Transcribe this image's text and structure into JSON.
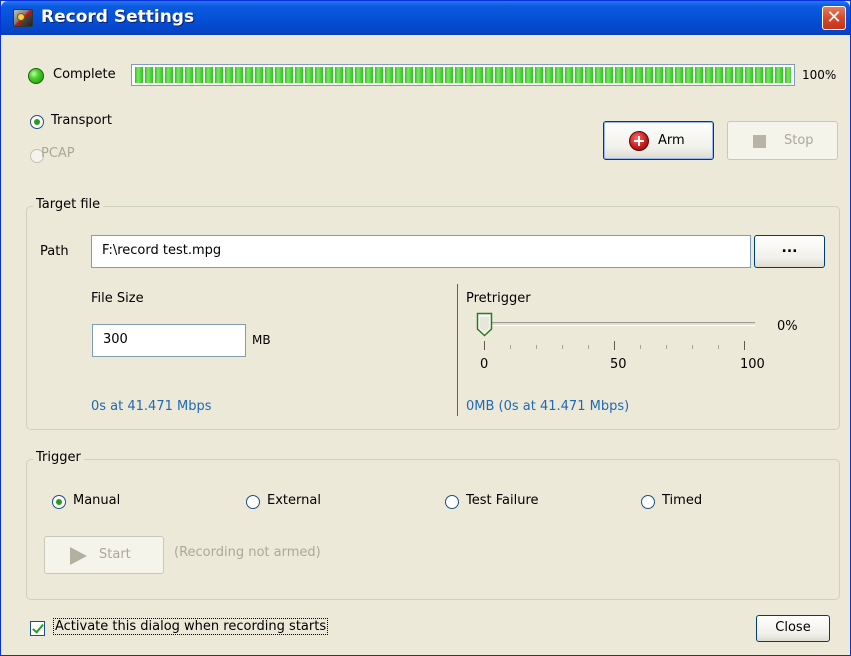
{
  "window": {
    "title": "Record Settings",
    "close_glyph": "✕"
  },
  "progress": {
    "status_label": "Complete",
    "value_percent": 100,
    "percent_label": "100%"
  },
  "mode": {
    "transport_label": "Transport",
    "pcap_label": "PCAP",
    "selected": "Transport"
  },
  "controls": {
    "arm_label": "Arm",
    "stop_label": "Stop"
  },
  "target_file": {
    "group_title": "Target file",
    "path_label": "Path",
    "path_value": "F:\\record test.mpg",
    "browse_label": "...",
    "file_size_label": "File Size",
    "file_size_value": "300",
    "file_size_unit": "MB",
    "file_size_info": "0s at 41.471 Mbps",
    "pretrigger_label": "Pretrigger",
    "pretrigger_value": 0,
    "pretrigger_pct_label": "0%",
    "pretrigger_ticks": [
      "0",
      "50",
      "100"
    ],
    "pretrigger_info": "0MB (0s at 41.471 Mbps)"
  },
  "trigger": {
    "group_title": "Trigger",
    "options": [
      "Manual",
      "External",
      "Test Failure",
      "Timed"
    ],
    "selected": "Manual",
    "start_label": "Start",
    "status_text": "(Recording not armed)"
  },
  "footer": {
    "activate_label": "Activate this dialog when recording starts",
    "activate_checked": true,
    "close_label": "Close"
  },
  "colors": {
    "titlebar": "#0552d8",
    "progress_green": "#2fc21c",
    "info_blue": "#2169b3",
    "dialog_bg": "#ece9d8"
  },
  "icons": {
    "app": "record-app-icon",
    "close": "close-icon",
    "led": "status-led-icon",
    "arm": "arm-plus-icon",
    "stop": "stop-square-icon",
    "start": "play-icon"
  }
}
